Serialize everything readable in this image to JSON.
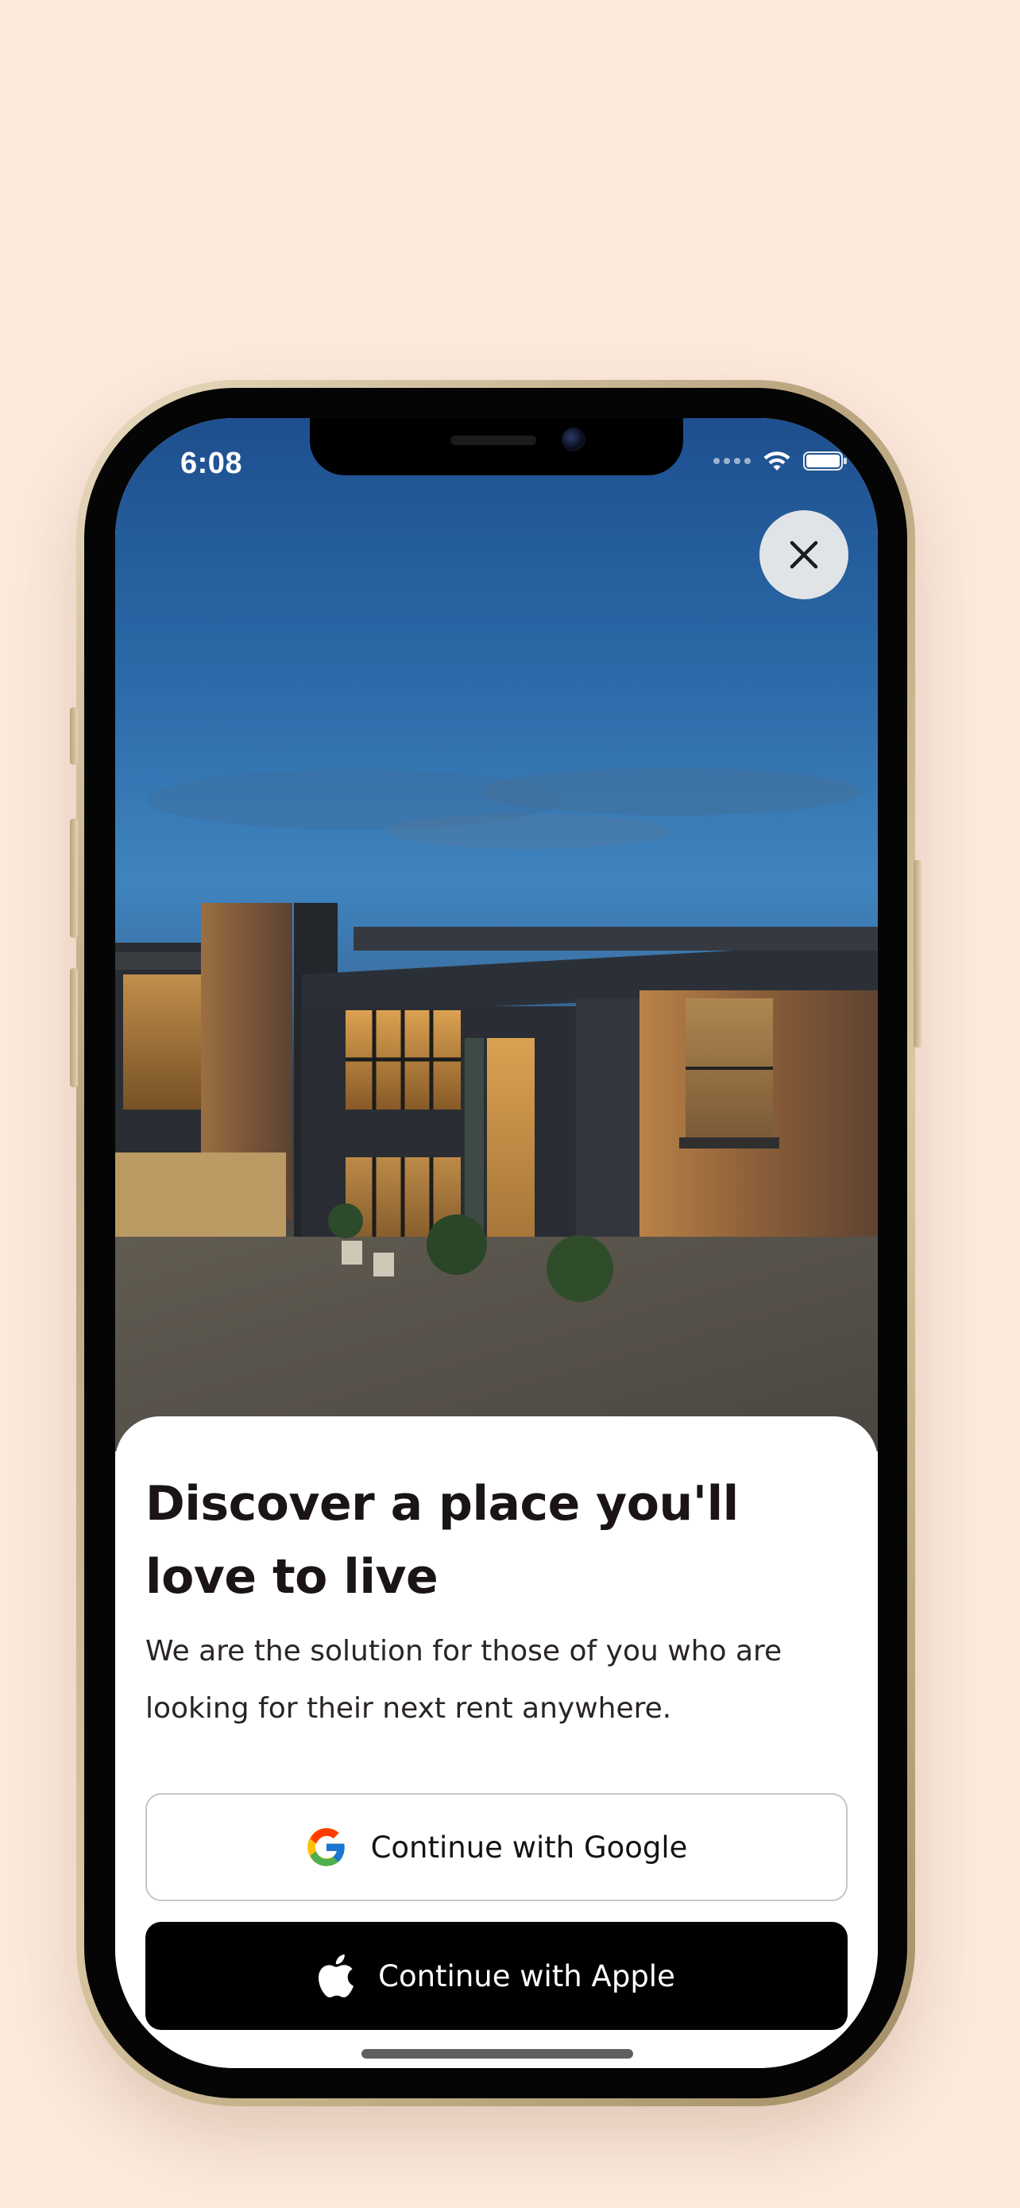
{
  "status_bar": {
    "time": "6:08",
    "wifi_icon": "wifi-icon",
    "battery_icon": "battery-icon"
  },
  "hero": {
    "image_icon": "house-photo",
    "close_icon": "close-icon"
  },
  "sheet": {
    "title": "Discover a place you'll love to live",
    "description": "We are the solution for those of you who are looking for their next rent anywhere."
  },
  "auth": {
    "google_label": "Continue with Google",
    "google_icon": "google-icon",
    "apple_label": "Continue with Apple",
    "apple_icon": "apple-icon"
  },
  "colors": {
    "background": "#fdeadd",
    "primary_button": "#000000",
    "text": "#1a1414"
  }
}
